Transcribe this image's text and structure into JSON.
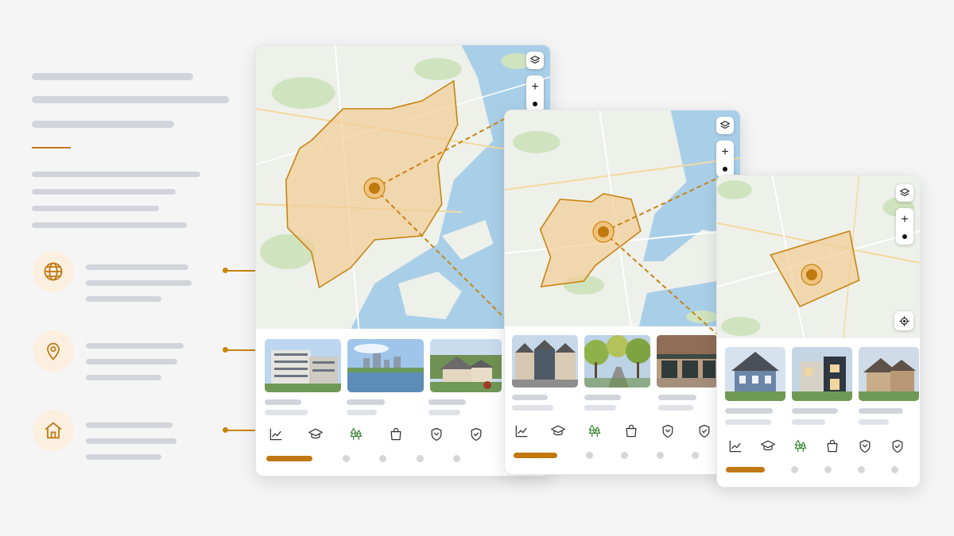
{
  "colors": {
    "accent": "#c0780f",
    "accent_light": "#fbefe0",
    "placeholder": "#d1d5db",
    "water": "#a9cfe8",
    "land": "#eef0ea",
    "park": "#cfe3bf",
    "region_fill": "#f2cc94",
    "region_stroke": "#c88410"
  },
  "features": [
    {
      "icon": "globe-icon"
    },
    {
      "icon": "location-pin-icon"
    },
    {
      "icon": "home-icon"
    }
  ],
  "map_controls": [
    "layers-icon",
    "zoom-in-icon",
    "zoom-level-dot",
    "locate-icon"
  ],
  "map_controls_labels": {
    "zoom_in": "+"
  },
  "category_icons": [
    "trend-chart-icon",
    "graduation-cap-icon",
    "trees-icon",
    "shopping-bag-icon",
    "police-badge-icon",
    "shield-check-icon"
  ],
  "cards": [
    {
      "name": "city-card",
      "photos": [
        "apartment-buildings",
        "waterfront-skyline",
        "suburban-house"
      ],
      "active_page": 1,
      "pages": 5
    },
    {
      "name": "neighborhood-card",
      "photos": [
        "townhouses",
        "tree-lined-street",
        "storefronts"
      ],
      "active_page": 1,
      "pages": 5
    },
    {
      "name": "block-card",
      "photos": [
        "blue-victorian-house",
        "modern-house",
        "brick-house"
      ],
      "active_page": 1,
      "pages": 5
    }
  ]
}
